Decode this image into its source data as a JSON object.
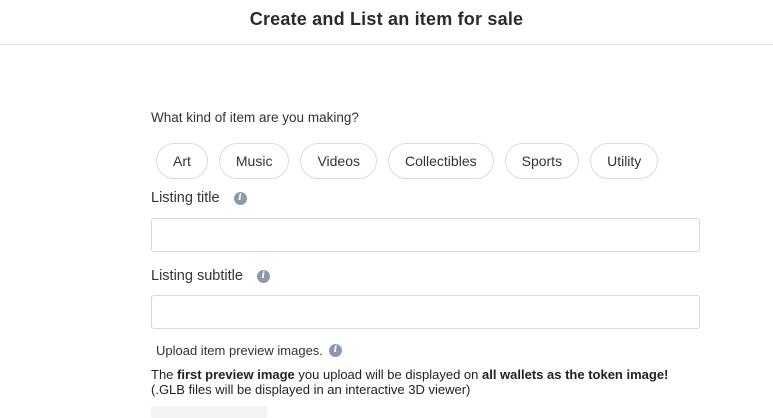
{
  "header": {
    "title": "Create and List an item for sale"
  },
  "item_kind": {
    "question": "What kind of item are you making?",
    "options": [
      "Art",
      "Music",
      "Videos",
      "Collectibles",
      "Sports",
      "Utility"
    ]
  },
  "listing_title": {
    "label": "Listing title",
    "value": "",
    "icon": "info-icon"
  },
  "listing_subtitle": {
    "label": "Listing subtitle",
    "value": "",
    "icon": "info-icon"
  },
  "upload": {
    "label": "Upload item preview images.",
    "desc_part1": "The ",
    "desc_bold1": "first preview image",
    "desc_part2": " you upload will be displayed on ",
    "desc_bold2": "all wallets as the token image!",
    "desc_line2": "(.GLB files will be displayed in an interactive 3D viewer)"
  },
  "colors": {
    "info_icon": "#8a9aac",
    "border": "#dcdcdc",
    "title_text": "#2b2b2b"
  }
}
